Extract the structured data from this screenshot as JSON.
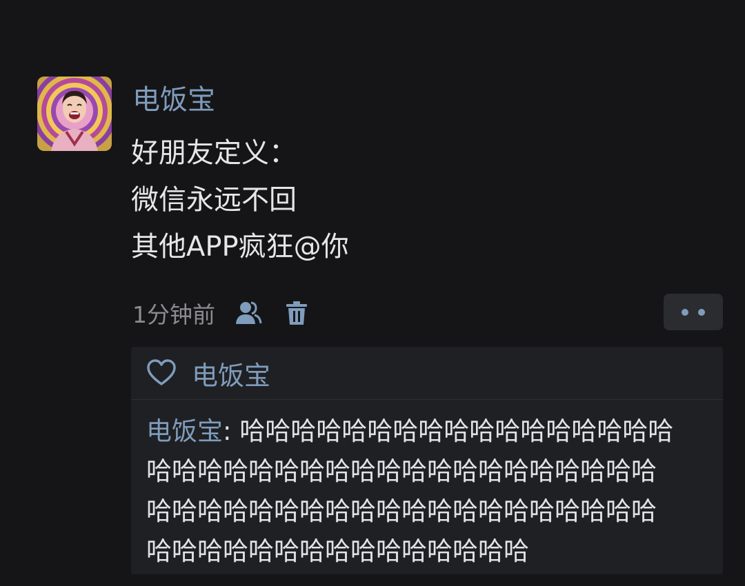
{
  "post": {
    "author": "电饭宝",
    "lines": [
      "好朋友定义：",
      "微信永远不回",
      "其他APP疯狂@你"
    ],
    "timestamp": "1分钟前"
  },
  "likes": {
    "names": "电饭宝"
  },
  "comment": {
    "author": "电饭宝",
    "separator": ": ",
    "line1": "哈哈哈哈哈哈哈哈哈哈哈哈哈哈哈哈哈",
    "line2": "哈哈哈哈哈哈哈哈哈哈哈哈哈哈哈哈哈哈哈哈",
    "line3": "哈哈哈哈哈哈哈哈哈哈哈哈哈哈哈哈哈哈哈哈",
    "line4": "哈哈哈哈哈哈哈哈哈哈哈哈哈哈哈"
  },
  "colors": {
    "background": "#151517",
    "name_link": "#7f9cbc",
    "panel": "#1f2023"
  },
  "icons": [
    "friends-icon",
    "trash-icon",
    "more-dots-icon",
    "heart-icon"
  ]
}
